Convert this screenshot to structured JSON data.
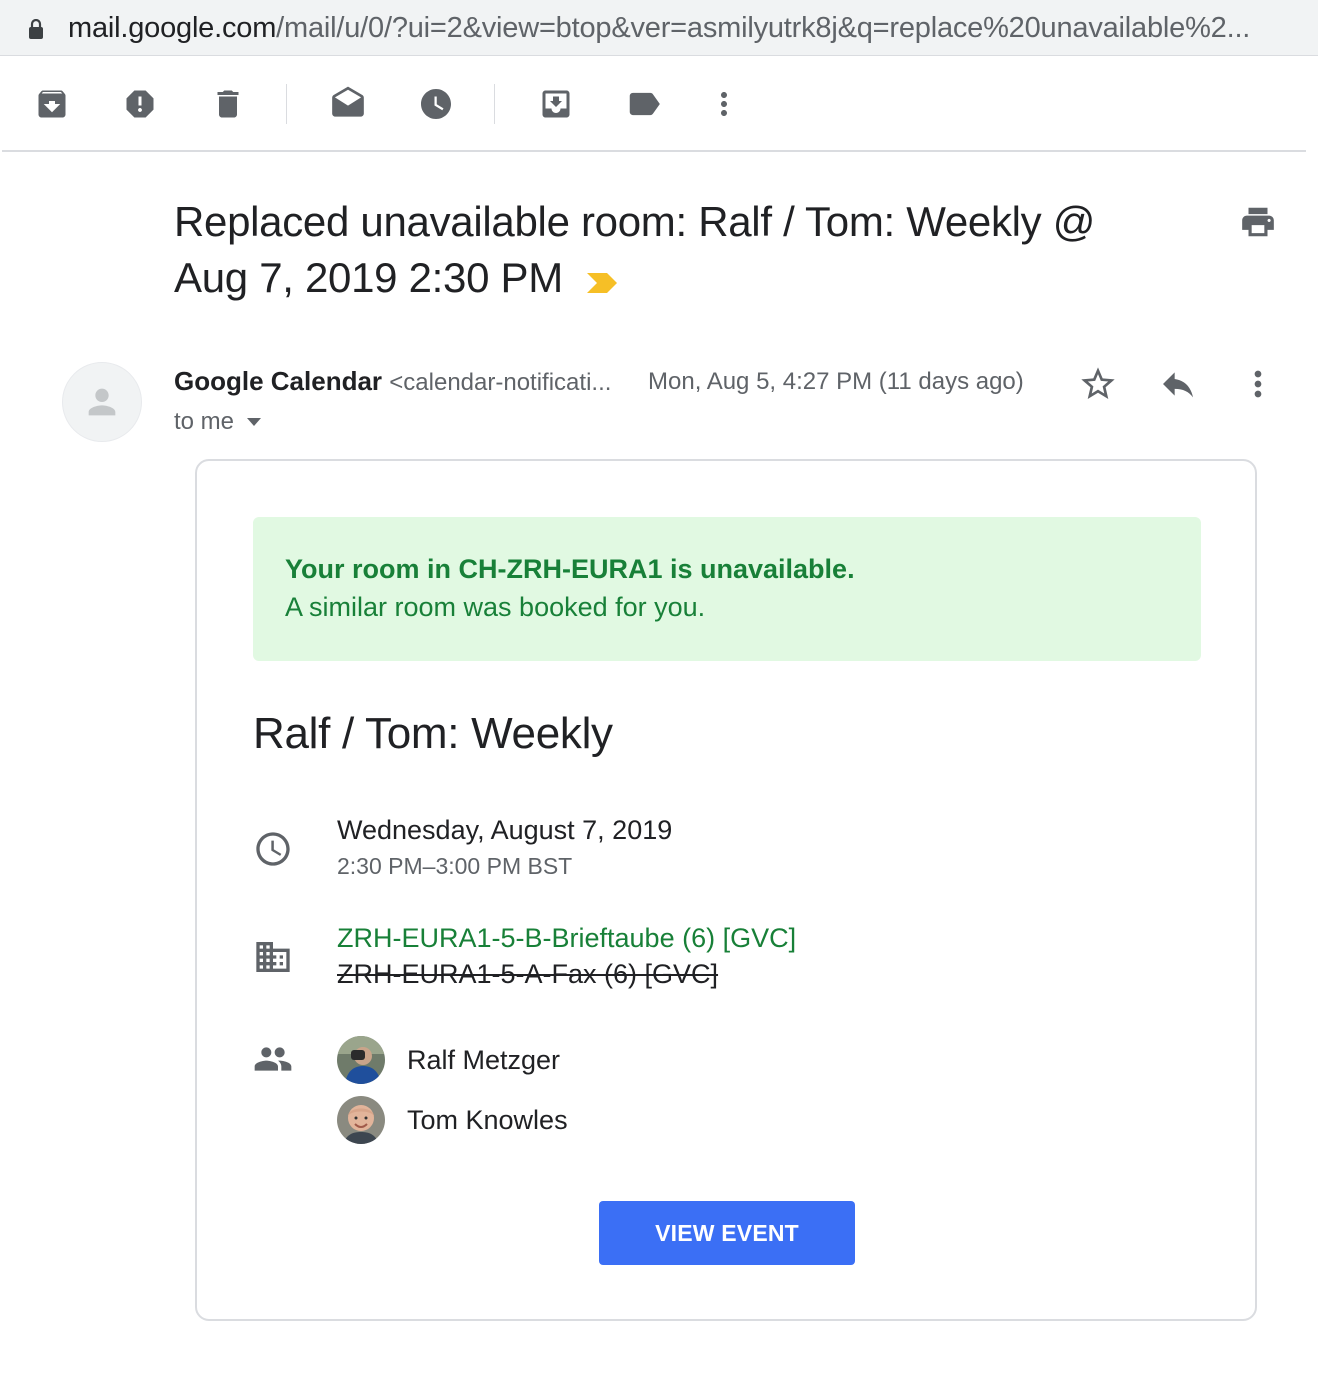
{
  "browser": {
    "url_host": "mail.google.com",
    "url_rest": "/mail/u/0/?ui=2&view=btop&ver=asmilyutrk8j&q=replace%20unavailable%2..."
  },
  "toolbar": {
    "icons": [
      "archive-icon",
      "report-spam-icon",
      "delete-icon",
      "mark-unread-icon",
      "snooze-icon",
      "move-to-icon",
      "label-icon",
      "more-vert-icon"
    ]
  },
  "message": {
    "subject_line1": "Replaced unavailable room: Ralf / Tom: Weekly @",
    "subject_line2": "Aug 7, 2019 2:30 PM",
    "sender_name": "Google Calendar",
    "sender_email": "<calendar-notificati...",
    "date": "Mon, Aug 5, 4:27 PM (11 days ago)",
    "recipient": "to me"
  },
  "card": {
    "notice_bold": "Your room in CH-ZRH-EURA1 is unavailable.",
    "notice_text": "A similar room was booked for you.",
    "event_title": "Ralf / Tom: Weekly",
    "date": "Wednesday, August 7, 2019",
    "time": "2:30 PM–3:00 PM BST",
    "room_new": "ZRH-EURA1-5-B-Brieftaube (6) [GVC]",
    "room_old": "ZRH-EURA1-5-A-Fax (6) [GVC]",
    "guests": [
      "Ralf Metzger",
      "Tom Knowles"
    ],
    "button": "VIEW EVENT"
  },
  "colors": {
    "accent_blue": "#3b6ff5",
    "notice_green": "#188038",
    "notice_bg": "#e1f9e2",
    "important_marker": "#f6bf26"
  }
}
